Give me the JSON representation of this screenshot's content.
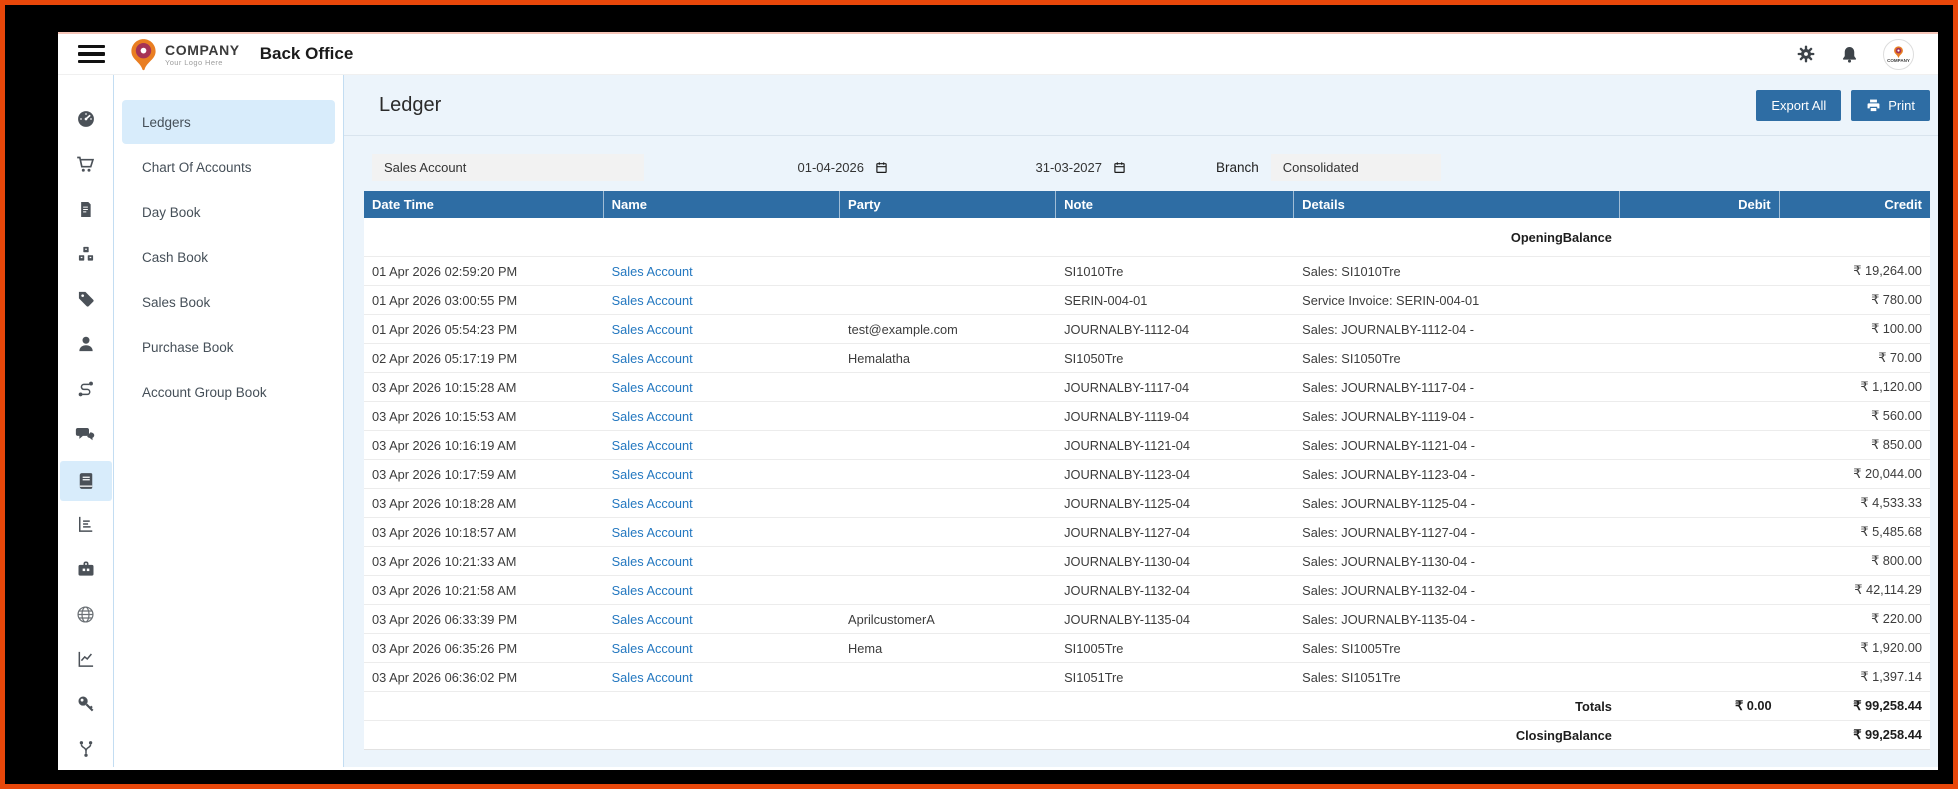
{
  "colors": {
    "frame_orange": "#e8470a",
    "header_blue": "#2e6da4",
    "content_bg": "#ecf4fb",
    "selected_bg": "#d8ecfb",
    "link_blue": "#2478c0",
    "topbar_accent_line": "#f5c5b8"
  },
  "header": {
    "brand_name": "COMPANY",
    "brand_tagline": "Your Logo Here",
    "app_title": "Back Office",
    "icons": [
      "menu-toggle-icon",
      "settings-gear-icon",
      "notifications-bell-icon",
      "user-avatar"
    ]
  },
  "sidebar": {
    "rail_icons": [
      "dashboard-gauge-icon",
      "cart-icon",
      "invoice-icon",
      "inventory-boxes-icon",
      "tag-icon",
      "person-icon",
      "route-icon",
      "chat-icon",
      "ledger-book-icon",
      "bar-chart-icon",
      "briefcase-icon",
      "globe-icon",
      "line-chart-icon",
      "key-icon",
      "branch-icon"
    ],
    "rail_selected_index": 8,
    "menu_items": [
      {
        "label": "Ledgers",
        "active": true
      },
      {
        "label": "Chart Of Accounts",
        "active": false
      },
      {
        "label": "Day Book",
        "active": false
      },
      {
        "label": "Cash Book",
        "active": false
      },
      {
        "label": "Sales Book",
        "active": false
      },
      {
        "label": "Purchase Book",
        "active": false
      },
      {
        "label": "Account Group Book",
        "active": false
      }
    ]
  },
  "main": {
    "page_title": "Ledger",
    "buttons": {
      "export_all": "Export All",
      "print": "Print"
    },
    "filters": {
      "account": "Sales Account",
      "date_from": "01-04-2026",
      "date_to": "31-03-2027",
      "branch_label": "Branch",
      "branch_value": "Consolidated"
    },
    "table": {
      "columns": [
        "Date Time",
        "Name",
        "Party",
        "Note",
        "Details",
        "Debit",
        "Credit"
      ],
      "opening_balance_label": "OpeningBalance",
      "rows": [
        {
          "datetime": "01 Apr 2026 02:59:20 PM",
          "name": "Sales Account",
          "party": "",
          "note": "SI1010Tre",
          "details": "Sales: SI1010Tre",
          "debit": "",
          "credit": "₹ 19,264.00"
        },
        {
          "datetime": "01 Apr 2026 03:00:55 PM",
          "name": "Sales Account",
          "party": "",
          "note": "SERIN-004-01",
          "details": "Service Invoice: SERIN-004-01",
          "debit": "",
          "credit": "₹ 780.00"
        },
        {
          "datetime": "01 Apr 2026 05:54:23 PM",
          "name": "Sales Account",
          "party": "test@example.com",
          "note": "JOURNALBY-1112-04",
          "details": "Sales: JOURNALBY-1112-04 -",
          "debit": "",
          "credit": "₹ 100.00"
        },
        {
          "datetime": "02 Apr 2026 05:17:19 PM",
          "name": "Sales Account",
          "party": "Hemalatha",
          "note": "SI1050Tre",
          "details": "Sales: SI1050Tre",
          "debit": "",
          "credit": "₹ 70.00"
        },
        {
          "datetime": "03 Apr 2026 10:15:28 AM",
          "name": "Sales Account",
          "party": "",
          "note": "JOURNALBY-1117-04",
          "details": "Sales: JOURNALBY-1117-04 -",
          "debit": "",
          "credit": "₹ 1,120.00"
        },
        {
          "datetime": "03 Apr 2026 10:15:53 AM",
          "name": "Sales Account",
          "party": "",
          "note": "JOURNALBY-1119-04",
          "details": "Sales: JOURNALBY-1119-04 -",
          "debit": "",
          "credit": "₹ 560.00"
        },
        {
          "datetime": "03 Apr 2026 10:16:19 AM",
          "name": "Sales Account",
          "party": "",
          "note": "JOURNALBY-1121-04",
          "details": "Sales: JOURNALBY-1121-04 -",
          "debit": "",
          "credit": "₹ 850.00"
        },
        {
          "datetime": "03 Apr 2026 10:17:59 AM",
          "name": "Sales Account",
          "party": "",
          "note": "JOURNALBY-1123-04",
          "details": "Sales: JOURNALBY-1123-04 -",
          "debit": "",
          "credit": "₹ 20,044.00"
        },
        {
          "datetime": "03 Apr 2026 10:18:28 AM",
          "name": "Sales Account",
          "party": "",
          "note": "JOURNALBY-1125-04",
          "details": "Sales: JOURNALBY-1125-04 -",
          "debit": "",
          "credit": "₹ 4,533.33"
        },
        {
          "datetime": "03 Apr 2026 10:18:57 AM",
          "name": "Sales Account",
          "party": "",
          "note": "JOURNALBY-1127-04",
          "details": "Sales: JOURNALBY-1127-04 -",
          "debit": "",
          "credit": "₹ 5,485.68"
        },
        {
          "datetime": "03 Apr 2026 10:21:33 AM",
          "name": "Sales Account",
          "party": "",
          "note": "JOURNALBY-1130-04",
          "details": "Sales: JOURNALBY-1130-04 -",
          "debit": "",
          "credit": "₹ 800.00"
        },
        {
          "datetime": "03 Apr 2026 10:21:58 AM",
          "name": "Sales Account",
          "party": "",
          "note": "JOURNALBY-1132-04",
          "details": "Sales: JOURNALBY-1132-04 -",
          "debit": "",
          "credit": "₹ 42,114.29"
        },
        {
          "datetime": "03 Apr 2026 06:33:39 PM",
          "name": "Sales Account",
          "party": "AprilcustomerA",
          "note": "JOURNALBY-1135-04",
          "details": "Sales: JOURNALBY-1135-04 -",
          "debit": "",
          "credit": "₹ 220.00"
        },
        {
          "datetime": "03 Apr 2026 06:35:26 PM",
          "name": "Sales Account",
          "party": "Hema",
          "note": "SI1005Tre",
          "details": "Sales: SI1005Tre",
          "debit": "",
          "credit": "₹ 1,920.00"
        },
        {
          "datetime": "03 Apr 2026 06:36:02 PM",
          "name": "Sales Account",
          "party": "",
          "note": "SI1051Tre",
          "details": "Sales: SI1051Tre",
          "debit": "",
          "credit": "₹ 1,397.14"
        }
      ],
      "totals": {
        "label": "Totals",
        "debit": "₹ 0.00",
        "credit": "₹ 99,258.44"
      },
      "closing": {
        "label": "ClosingBalance",
        "credit": "₹ 99,258.44"
      }
    }
  }
}
